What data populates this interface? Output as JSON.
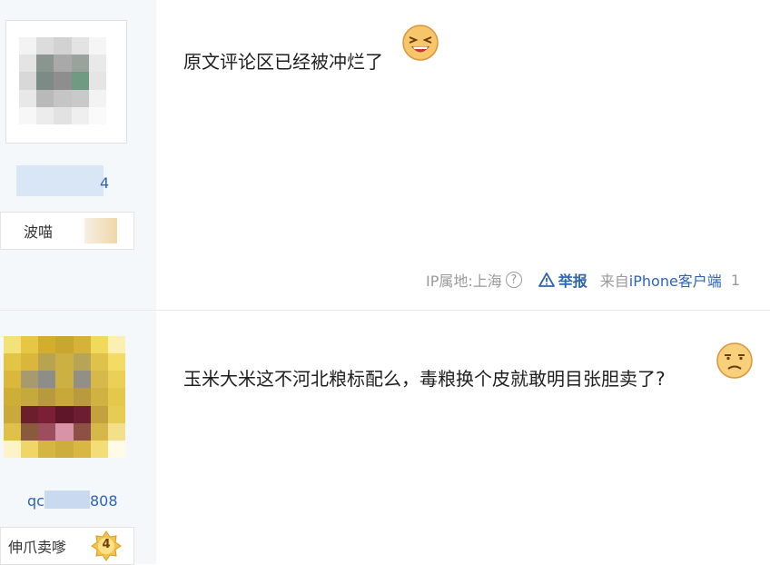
{
  "posts": [
    {
      "username": "4",
      "badge_text": "波喵",
      "content": "原文评论区已经被冲烂了",
      "content_emoji": "laughing-face-icon",
      "meta": {
        "ip_label": "IP属地:上海",
        "help_icon": "?",
        "report_label": "举报",
        "from_label": "来自",
        "device": "iPhone客户端",
        "floor": "1"
      }
    },
    {
      "username_prefix": "qc",
      "username_suffix": "808",
      "badge_text": "伸爪卖嗲",
      "level": "4",
      "content": "玉米大米这不河北粮标配么，毒粮换个皮就敢明目张胆卖了?",
      "content_emoji": "frowning-face-icon"
    }
  ],
  "colors": {
    "link": "#2d64b3",
    "sidebar_bg": "#f5f8fb",
    "meta_gray": "#9a9a9a"
  }
}
